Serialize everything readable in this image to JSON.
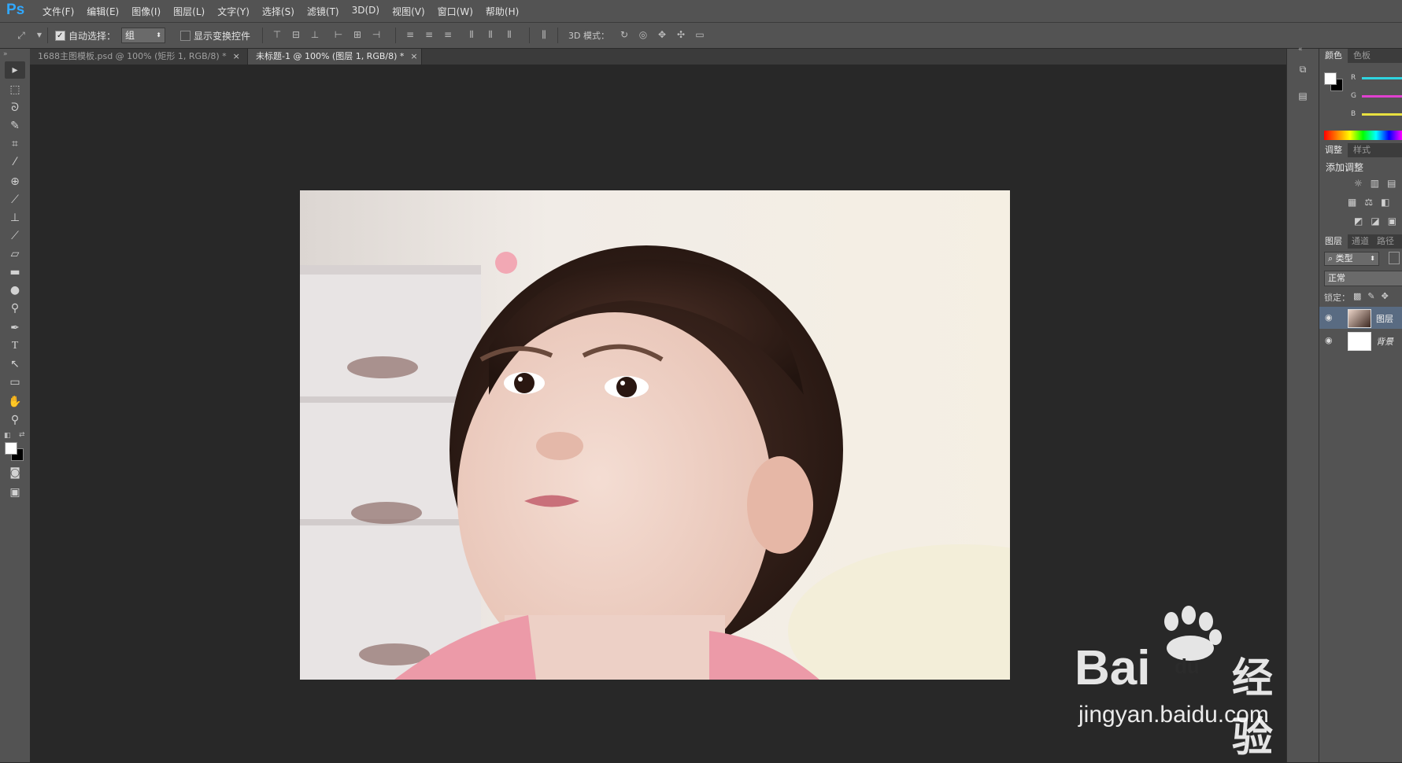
{
  "app": {
    "logo": "Ps"
  },
  "menu": [
    "文件(F)",
    "编辑(E)",
    "图像(I)",
    "图层(L)",
    "文字(Y)",
    "选择(S)",
    "滤镜(T)",
    "3D(D)",
    "视图(V)",
    "窗口(W)",
    "帮助(H)"
  ],
  "options": {
    "auto_select_label": "自动选择：",
    "auto_select_value": "组",
    "show_transform_label": "显示变换控件",
    "mode_3d_label": "3D 模式："
  },
  "tabs": [
    {
      "label": "1688主图模板.psd @ 100% (矩形 1, RGB/8) *",
      "close": "×"
    },
    {
      "label": "未标题-1 @ 100% (图层 1, RGB/8) *",
      "close": "×"
    }
  ],
  "panels": {
    "color_tabs": [
      "颜色",
      "色板"
    ],
    "rgb_labels": [
      "R",
      "G",
      "B"
    ],
    "adjust_tabs": [
      "调整",
      "样式"
    ],
    "add_adjustment": "添加调整",
    "layers_tabs": [
      "图层",
      "通道",
      "路径"
    ],
    "kind_filter": "类型",
    "blend_mode": "正常",
    "lock_label": "锁定：",
    "layers": [
      {
        "name": "图层"
      },
      {
        "name": "背景"
      }
    ]
  },
  "watermark": {
    "brand_a": "Bai",
    "brand_b": "经验",
    "paw_text": "du",
    "url": "jingyan.baidu.com"
  },
  "colors": {
    "chrome": "#535353",
    "canvas_bg": "#282828",
    "accent": "#31a8ff"
  }
}
